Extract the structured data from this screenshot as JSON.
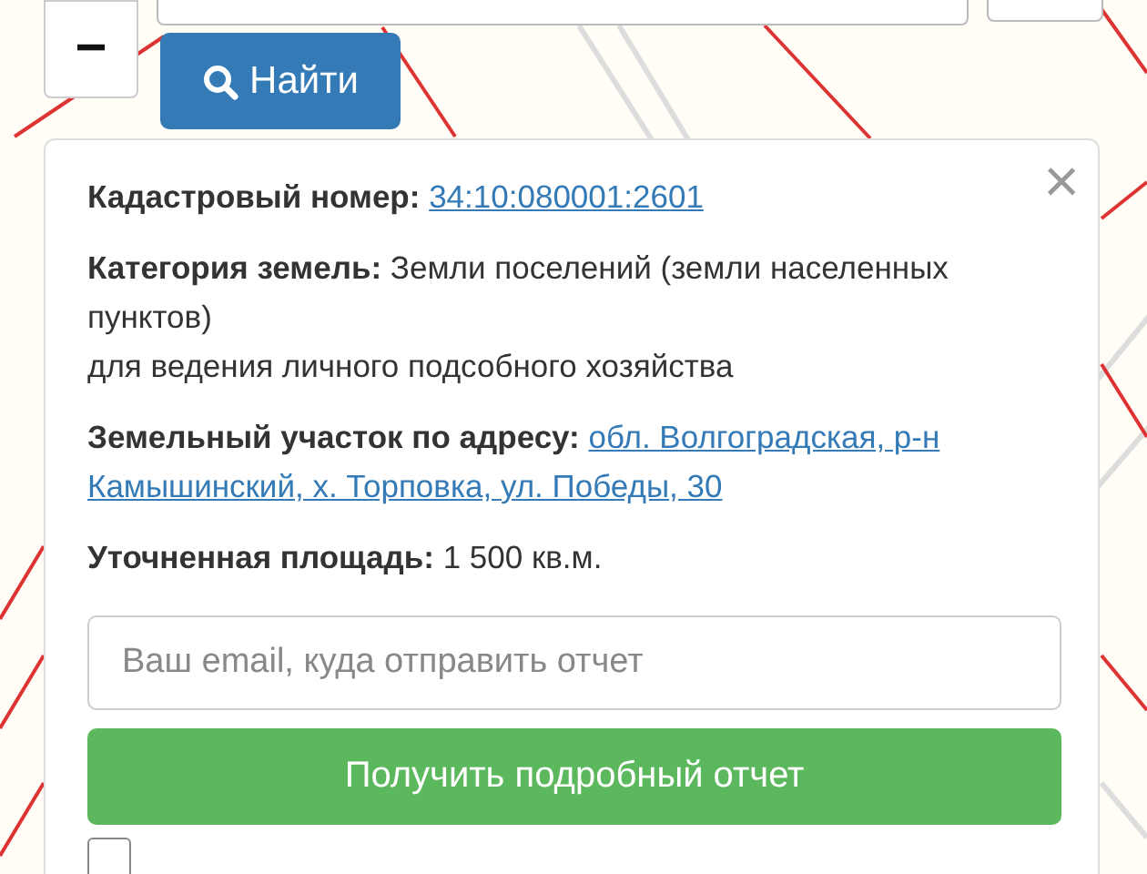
{
  "zoom_out": {
    "label": "−"
  },
  "search_button": {
    "label": "Найти"
  },
  "popup": {
    "close": "×",
    "rows": [
      {
        "kind": "link",
        "label": "Кадастровый номер:",
        "value": "34:10:080001:2601"
      },
      {
        "kind": "text",
        "label": "Категория земель:",
        "value": "Земли поселений (земли населенных пунктов)",
        "note": "для ведения личного подсобного хозяйства"
      },
      {
        "kind": "link",
        "label": "Земельный участок по адресу:",
        "value": "обл. Волгоградская, р-н Камышинский, х. Торповка, ул. Победы, 30"
      },
      {
        "kind": "text",
        "label": "Уточненная площадь:",
        "value": "1 500 кв.м."
      }
    ],
    "email": {
      "placeholder": "Ваш email, куда отправить отчет"
    },
    "report_button": {
      "label": "Получить подробный отчет"
    },
    "consent": {
      "checked": false
    }
  }
}
